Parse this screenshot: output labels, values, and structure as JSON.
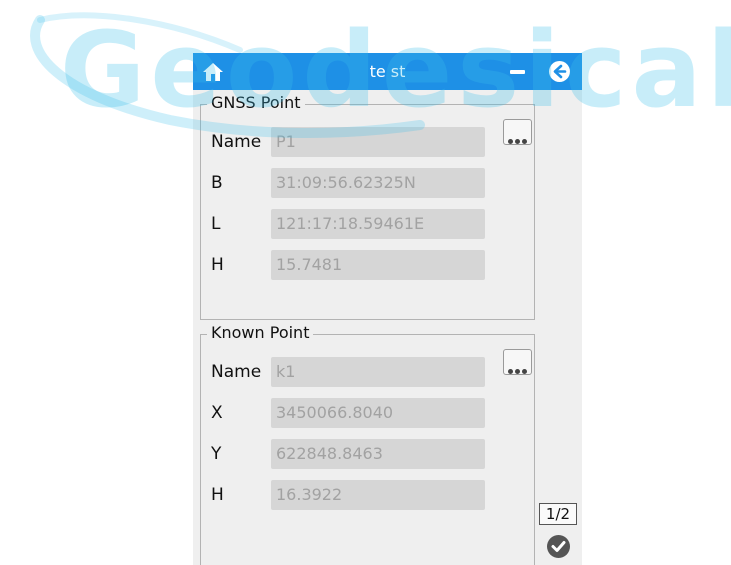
{
  "app": {
    "title": "te st"
  },
  "watermark": {
    "text": "Geodesical"
  },
  "gnss_point": {
    "title": "GNSS Point",
    "rows": [
      {
        "label": "Name",
        "value": "P1"
      },
      {
        "label": "B",
        "value": "31:09:56.62325N"
      },
      {
        "label": "L",
        "value": "121:17:18.59461E"
      },
      {
        "label": "H",
        "value": "15.7481"
      }
    ]
  },
  "known_point": {
    "title": "Known Point",
    "rows": [
      {
        "label": "Name",
        "value": "k1"
      },
      {
        "label": "X",
        "value": "3450066.8040"
      },
      {
        "label": "Y",
        "value": "622848.8463"
      },
      {
        "label": "H",
        "value": "16.3922"
      }
    ]
  },
  "pagination": {
    "indicator": "1/2"
  },
  "icons": {
    "home": "home-icon",
    "minimize": "minimize-icon",
    "back": "back-arrow-icon",
    "more": "more-dots-icon",
    "confirm": "check-icon"
  },
  "colors": {
    "topbar": "#1e90e6",
    "background": "#efefef",
    "field": "#d6d6d6",
    "field_text": "#a2a2a2",
    "watermark": "#3cc0ea"
  }
}
